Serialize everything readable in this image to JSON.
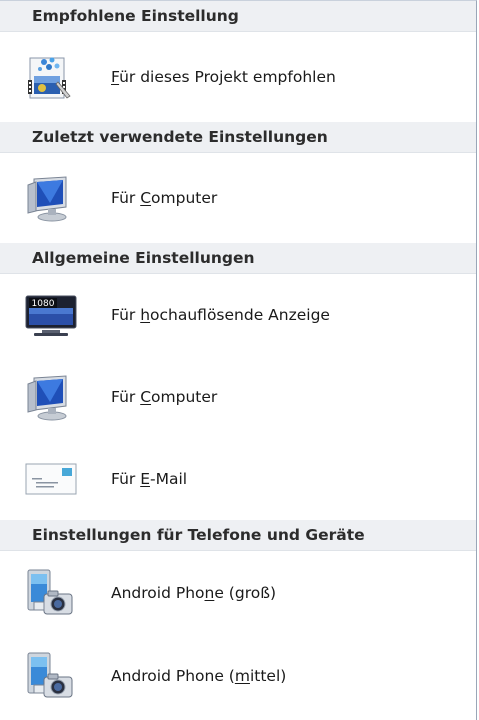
{
  "sections": [
    {
      "header": "Empfohlene Einstellung",
      "items": [
        {
          "icon": "video-project-icon",
          "pre": "",
          "acc": "F",
          "post": "ür dieses Projekt empfohlen"
        }
      ]
    },
    {
      "header": "Zuletzt verwendete Einstellungen",
      "items": [
        {
          "icon": "computer-monitor-icon",
          "pre": "Für ",
          "acc": "C",
          "post": "omputer"
        }
      ]
    },
    {
      "header": "Allgemeine Einstellungen",
      "items": [
        {
          "icon": "hd-display-1080-icon",
          "badge": "1080",
          "pre": "Für ",
          "acc": "h",
          "post": "ochauflösende Anzeige"
        },
        {
          "icon": "computer-monitor-icon",
          "pre": "Für ",
          "acc": "C",
          "post": "omputer"
        },
        {
          "icon": "email-envelope-icon",
          "pre": "Für ",
          "acc": "E",
          "post": "-Mail"
        }
      ]
    },
    {
      "header": "Einstellungen für Telefone und Geräte",
      "items": [
        {
          "icon": "android-phone-camera-icon",
          "pre": "Android Pho",
          "acc": "n",
          "post": "e (groß)"
        },
        {
          "icon": "android-phone-camera-icon",
          "pre": "Android Phone (",
          "acc": "m",
          "post": "ittel)"
        }
      ]
    }
  ]
}
